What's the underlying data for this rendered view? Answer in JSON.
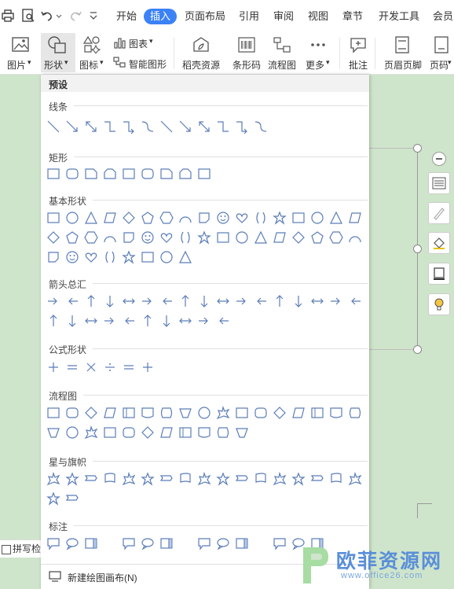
{
  "tabs": [
    "开始",
    "插入",
    "页面布局",
    "引用",
    "审阅",
    "视图",
    "章节",
    "开发工具",
    "会员"
  ],
  "ribbon": {
    "picture": "图片",
    "shape": "形状",
    "icon": "图标",
    "chart": "图表",
    "smart_art": "智能图形",
    "resources": "稻壳资源",
    "barcode": "条形码",
    "flowchart": "流程图",
    "more": "更多",
    "comment": "批注",
    "header_footer": "页眉页脚",
    "page_num": "页码"
  },
  "panel": {
    "header": "预设",
    "sections": {
      "lines": {
        "title": "线条",
        "count": 12
      },
      "rects": {
        "title": "矩形",
        "count": 9
      },
      "basic": {
        "title": "基本形状",
        "count": 42
      },
      "arrows": {
        "title": "箭头总汇",
        "count": 27
      },
      "formula": {
        "title": "公式形状",
        "count": 6
      },
      "flow": {
        "title": "流程图",
        "count": 28
      },
      "stars": {
        "title": "星与旗帜",
        "count": 19
      },
      "callouts": {
        "title": "标注",
        "count": 16
      }
    },
    "footer": "新建绘图画布(N)"
  },
  "status": {
    "text": "拼写检查"
  },
  "watermark": {
    "title": "欧菲资源网",
    "subtitle": "www.office26.com"
  },
  "colors": {
    "accent": "#3b82f6",
    "document_bg": "#cfe5cb",
    "shape_stroke": "#5b7db8"
  }
}
